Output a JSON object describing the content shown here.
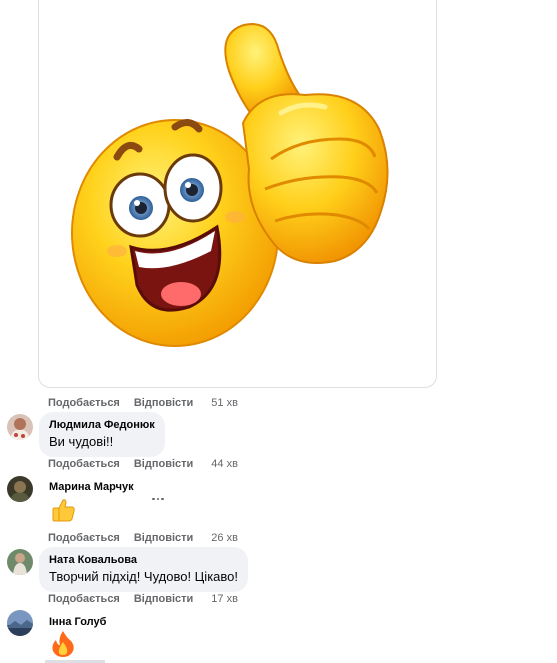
{
  "post_image": {
    "alt_icon": "thumbs-up-smiley-icon"
  },
  "actions": {
    "like": "Подобається",
    "reply": "Відповісти"
  },
  "comments": [
    {
      "author": "Людмила Федонюк",
      "text": "Ви чудові!!",
      "time": "44 хв"
    },
    {
      "author": "Марина Марчук",
      "emoji": "thumbs-up-emoji",
      "time": "26 хв"
    },
    {
      "author": "Ната Ковальова",
      "text": "Творчий підхід! Чудово! Цікаво!",
      "time": "17 хв"
    },
    {
      "author": "Інна Голуб",
      "emoji": "fire-emoji"
    }
  ],
  "image_comment_time": "51 хв",
  "colors": {
    "bubble": "#f0f2f5",
    "meta": "#65676b",
    "border": "#dcdfe4"
  }
}
